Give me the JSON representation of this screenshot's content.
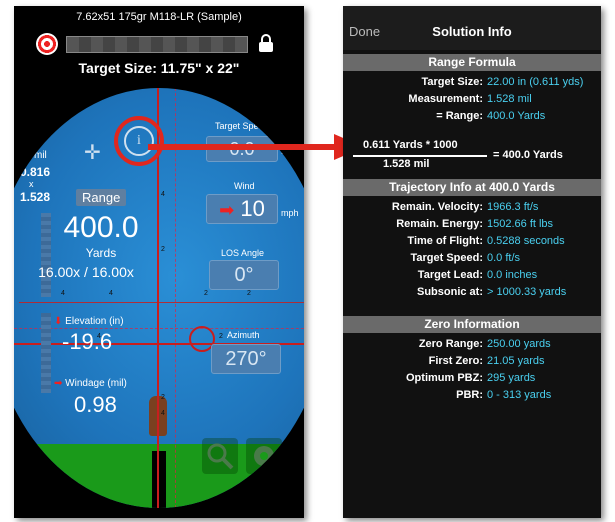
{
  "left": {
    "cartridge": "7.62x51 175gr M118-LR (Sample)",
    "target_size": "Target Size: 11.75\" x 22\"",
    "mil_label": "mil",
    "mil_top_value": "0.816",
    "x_label": "x",
    "mil_bottom_value": "1.528",
    "range_button": "Range",
    "range_value": "400.0",
    "range_unit": "Yards",
    "magnification": "16.00x / 16.00x",
    "elevation_label": "Elevation (in)",
    "elevation_value": "-19.6",
    "windage_label": "Windage (mil)",
    "windage_value": "0.98",
    "target_speed_label": "Target Speed",
    "target_speed_value": "0.0",
    "target_speed_unit": "ft/s",
    "wind_label": "Wind",
    "wind_value": "10",
    "wind_unit": "mph",
    "los_angle_label": "LOS Angle",
    "los_angle_value": "0°",
    "azimuth_label": "Azimuth",
    "azimuth_value": "270°",
    "reticle_ticks": [
      "4",
      "2",
      "2",
      "4",
      "4",
      "2",
      "2",
      "4",
      "2",
      "4"
    ]
  },
  "right": {
    "done": "Done",
    "title": "Solution Info",
    "range_formula": {
      "header": "Range Formula",
      "rows": [
        {
          "label": "Target Size:",
          "value": "22.00 in (0.611 yds)"
        },
        {
          "label": "Measurement:",
          "value": "1.528 mil"
        },
        {
          "label": "= Range:",
          "value": "400.0 Yards"
        }
      ],
      "numerator": "0.611 Yards * 1000",
      "denominator": "1.528 mil",
      "result": "= 400.0 Yards"
    },
    "trajectory": {
      "header": "Trajectory Info at 400.0 Yards",
      "rows": [
        {
          "label": "Remain. Velocity:",
          "value": "1966.3 ft/s"
        },
        {
          "label": "Remain. Energy:",
          "value": "1502.66 ft lbs"
        },
        {
          "label": "Time of Flight:",
          "value": "0.5288 seconds"
        },
        {
          "label": "Target Speed:",
          "value": "0.0 ft/s"
        },
        {
          "label": "Target Lead:",
          "value": "0.0 inches"
        },
        {
          "label": "Subsonic at:",
          "value": "> 1000.33 yards"
        }
      ]
    },
    "zero": {
      "header": "Zero Information",
      "rows": [
        {
          "label": "Zero Range:",
          "value": "250.00 yards"
        },
        {
          "label": "First Zero:",
          "value": "21.05 yards"
        },
        {
          "label": "Optimum PBZ:",
          "value": "295 yards"
        },
        {
          "label": "PBR:",
          "value": "0 - 313 yards"
        }
      ]
    }
  },
  "colors": {
    "accent_value": "#4ad0f0",
    "highlight_red": "#e0271e",
    "section_grey": "#6a6a6a"
  }
}
